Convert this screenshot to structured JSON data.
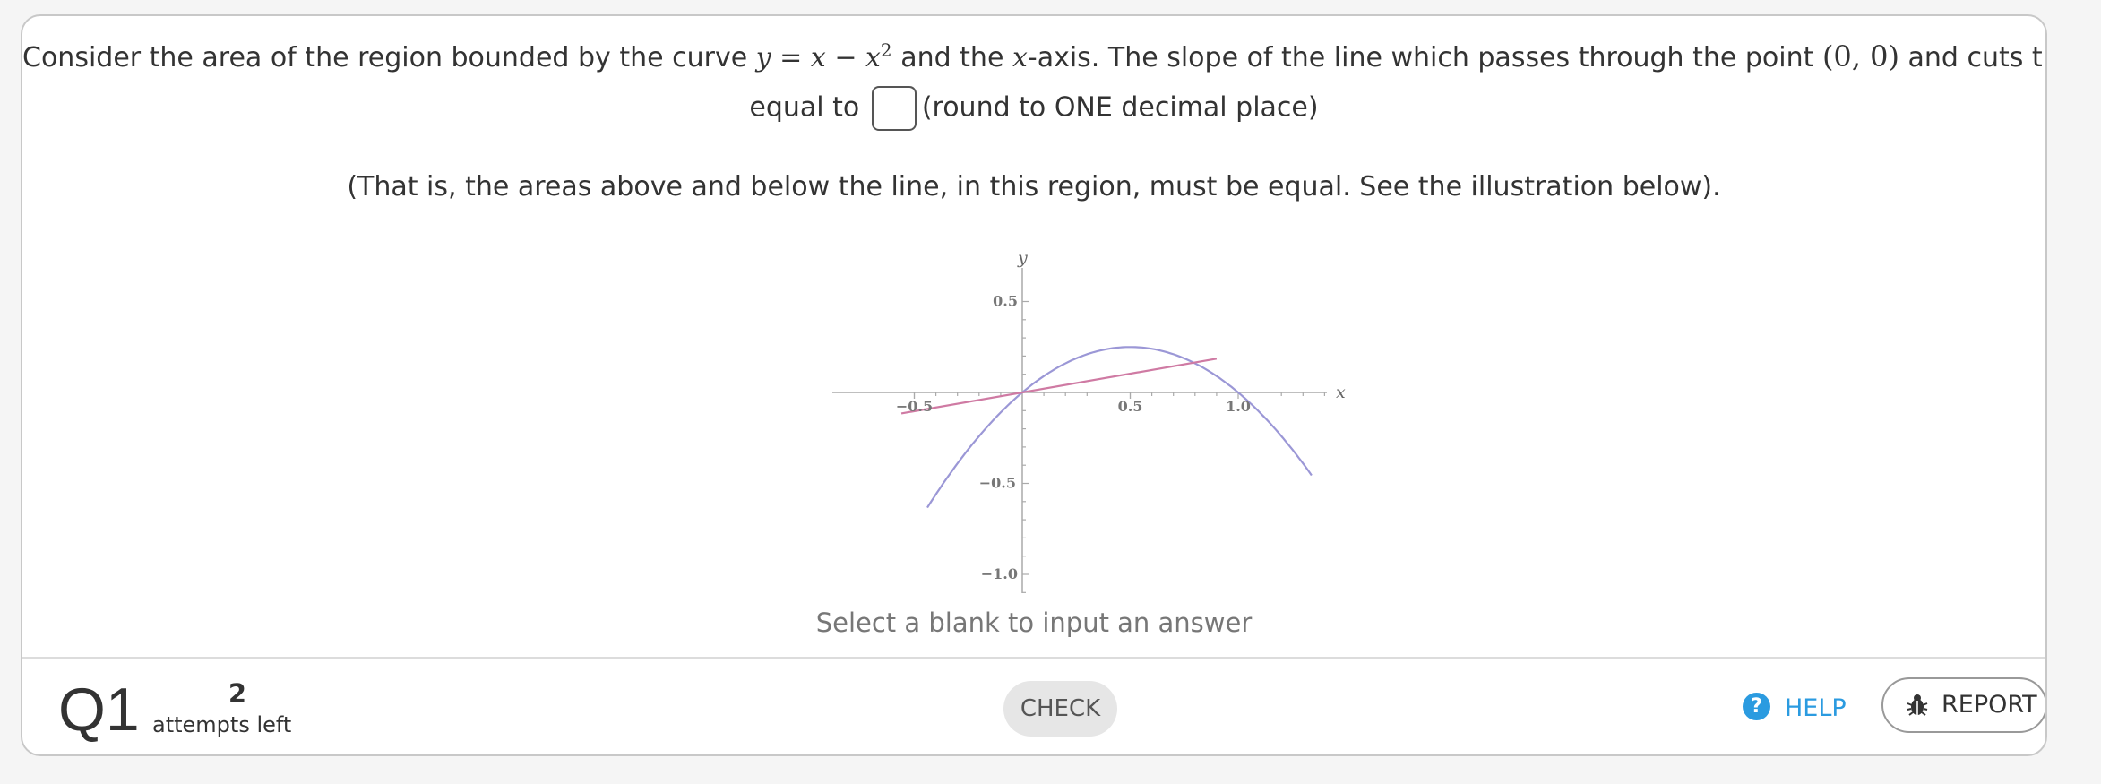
{
  "question": {
    "line1_prefix": "Consider the area of the region bounded by the curve ",
    "curve_y": "y",
    "curve_eq": " = ",
    "curve_x1": "x",
    "curve_minus": " − ",
    "curve_x2": "x",
    "curve_exp": "2",
    "line1_mid": " and the ",
    "axis_var": "x",
    "line1_mid2": "-axis. The slope of the line which passes through the point ",
    "point": "(0, 0)",
    "line1_suffix": " and cuts this area in half is",
    "line2_prefix": "equal to",
    "line2_suffix": "(round to ONE decimal place)",
    "note": "(That is, the areas above and below the line, in this region, must be equal. See the illustration below)."
  },
  "graph": {
    "axis_y_label": "y",
    "axis_x_label": "x",
    "xtick_labels": [
      "−0.5",
      "0.5",
      "1.0"
    ],
    "ytick_labels": [
      "0.5",
      "−0.5",
      "−1.0"
    ],
    "curve_color": "#9b97d6",
    "line_color": "#cf7aa3"
  },
  "hint": "Select a blank to input an answer",
  "footer": {
    "question_number": "Q1",
    "attempts_count": "2",
    "attempts_label": "attempts left",
    "check_label": "CHECK",
    "help_label": "HELP",
    "report_label": "REPORT"
  }
}
